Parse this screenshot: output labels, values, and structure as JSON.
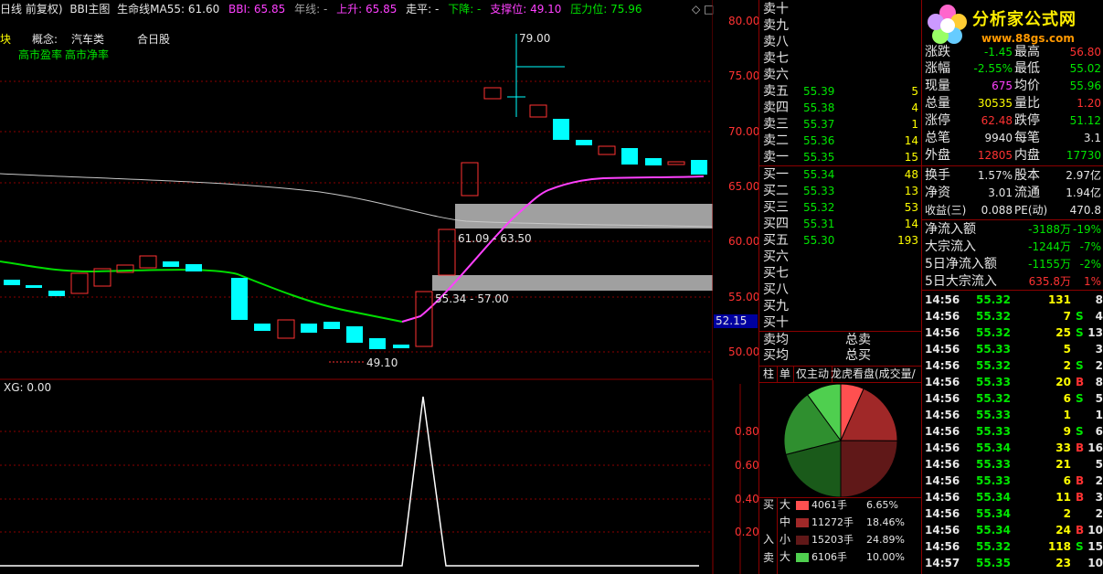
{
  "header": {
    "period": "日线 前复权)",
    "main_indicator": "BBI主图",
    "ma55": "生命线MA55: 61.60",
    "bbi": "BBI: 65.85",
    "nian": "年线: -",
    "up": "上升: 65.85",
    "flat": "走平: -",
    "down": "下降: -",
    "support": "支撑位: 49.10",
    "resistance": "压力位: 75.96"
  },
  "tags": {
    "sector": "块",
    "concept_label": "概念:",
    "concept_value": "汽车类",
    "concept_extra": "合日股",
    "tag1": "高市盈率",
    "tag2": "高市净率"
  },
  "annotations": {
    "high_label": "79.00",
    "low_label": "49.10",
    "zone_upper": "61.09 - 63.50",
    "zone_lower": "55.34 - 57.00",
    "current_price_tag": "52.15"
  },
  "y_axis_main": [
    "80.00",
    "75.00",
    "70.00",
    "65.00",
    "60.00",
    "55.00",
    "50.00"
  ],
  "sub_chart": {
    "title": "XG: 0.00",
    "y_axis": [
      "0.80",
      "0.60",
      "0.40",
      "0.20"
    ]
  },
  "order_book": {
    "sell": [
      {
        "label": "卖十",
        "price": "",
        "vol": ""
      },
      {
        "label": "卖九",
        "price": "",
        "vol": ""
      },
      {
        "label": "卖八",
        "price": "",
        "vol": ""
      },
      {
        "label": "卖七",
        "price": "",
        "vol": ""
      },
      {
        "label": "卖六",
        "price": "",
        "vol": ""
      },
      {
        "label": "卖五",
        "price": "55.39",
        "vol": "5"
      },
      {
        "label": "卖四",
        "price": "55.38",
        "vol": "4"
      },
      {
        "label": "卖三",
        "price": "55.37",
        "vol": "1"
      },
      {
        "label": "卖二",
        "price": "55.36",
        "vol": "14"
      },
      {
        "label": "卖一",
        "price": "55.35",
        "vol": "15"
      }
    ],
    "buy": [
      {
        "label": "买一",
        "price": "55.34",
        "vol": "48"
      },
      {
        "label": "买二",
        "price": "55.33",
        "vol": "13"
      },
      {
        "label": "买三",
        "price": "55.32",
        "vol": "53"
      },
      {
        "label": "买四",
        "price": "55.31",
        "vol": "14"
      },
      {
        "label": "买五",
        "price": "55.30",
        "vol": "193"
      },
      {
        "label": "买六",
        "price": "",
        "vol": ""
      },
      {
        "label": "买七",
        "price": "",
        "vol": ""
      },
      {
        "label": "买八",
        "price": "",
        "vol": ""
      },
      {
        "label": "买九",
        "price": "",
        "vol": ""
      },
      {
        "label": "买十",
        "price": "",
        "vol": ""
      }
    ],
    "avg": {
      "sell_avg": "卖均",
      "buy_avg": "买均",
      "total_sell": "总卖",
      "total_buy": "总买"
    }
  },
  "tabs": [
    "柱",
    "单",
    "仅主动",
    "龙虎看盘(成交量/形"
  ],
  "pie": {
    "slices": [
      {
        "name": "大买",
        "pct": 6.65,
        "color": "#ff5050"
      },
      {
        "name": "中买",
        "pct": 18.46,
        "color": "#a02828"
      },
      {
        "name": "小买",
        "pct": 24.89,
        "color": "#601818"
      },
      {
        "name": "小卖",
        "pct": 21.0,
        "color": "#1a5a1a"
      },
      {
        "name": "中卖",
        "pct": 19.0,
        "color": "#2f8f2f"
      },
      {
        "name": "大卖",
        "pct": 10.0,
        "color": "#4fcf4f"
      }
    ]
  },
  "flow_legend": {
    "buy_label": "买",
    "in_label": "入",
    "sell_label": "卖",
    "rows": [
      {
        "size": "大",
        "amount": "4061手",
        "pct": "6.65%",
        "color": "#ff5050"
      },
      {
        "size": "中",
        "amount": "11272手",
        "pct": "18.46%",
        "color": "#a02828"
      },
      {
        "size": "小",
        "amount": "15203手",
        "pct": "24.89%",
        "color": "#601818"
      },
      {
        "size": "大",
        "amount": "6106手",
        "pct": "10.00%",
        "color": "#4fcf4f"
      }
    ]
  },
  "logo": {
    "title": "分析家公式网",
    "url": "www.88gs.com"
  },
  "quote": {
    "top_partial": {
      "l": "涨跌",
      "v": "-1.45",
      "l2": "最高",
      "v2": "56.80"
    },
    "rows": [
      {
        "l": "涨幅",
        "v": "-2.55%",
        "vc": "green",
        "l2": "最低",
        "v2": "55.02",
        "v2c": "green"
      },
      {
        "l": "现量",
        "v": "675",
        "vc": "mag",
        "l2": "均价",
        "v2": "55.96",
        "v2c": "green"
      },
      {
        "l": "总量",
        "v": "30535",
        "vc": "yellow",
        "l2": "量比",
        "v2": "1.20",
        "v2c": "red"
      },
      {
        "l": "涨停",
        "v": "62.48",
        "vc": "red",
        "l2": "跌停",
        "v2": "51.12",
        "v2c": "green"
      },
      {
        "l": "总笔",
        "v": "9940",
        "vc": "white",
        "l2": "每笔",
        "v2": "3.1",
        "v2c": "white"
      },
      {
        "l": "外盘",
        "v": "12805",
        "vc": "red",
        "l2": "内盘",
        "v2": "17730",
        "v2c": "green"
      }
    ],
    "rows2": [
      {
        "l": "换手",
        "v": "1.57%",
        "l2": "股本",
        "v2": "2.97亿"
      },
      {
        "l": "净资",
        "v": "3.01",
        "l2": "流通",
        "v2": "1.94亿"
      },
      {
        "l": "收益(三)",
        "v": "0.088",
        "l2": "PE(动)",
        "v2": "470.8"
      }
    ],
    "flows": [
      {
        "l": "净流入额",
        "v": "-3188万",
        "p": "-19%"
      },
      {
        "l": "大宗流入",
        "v": "-1244万",
        "p": "-7%"
      },
      {
        "l": "5日净流入额",
        "v": "-1155万",
        "p": "-2%"
      },
      {
        "l": "5日大宗流入",
        "v": "635.8万",
        "p": "1%"
      }
    ]
  },
  "ticks": [
    {
      "time": "14:56",
      "price": "55.32",
      "vol": "131",
      "side": "",
      "n": "8"
    },
    {
      "time": "14:56",
      "price": "55.32",
      "vol": "7",
      "side": "S",
      "n": "4"
    },
    {
      "time": "14:56",
      "price": "55.32",
      "vol": "25",
      "side": "S",
      "n": "13"
    },
    {
      "time": "14:56",
      "price": "55.33",
      "vol": "5",
      "side": "",
      "n": "3"
    },
    {
      "time": "14:56",
      "price": "55.32",
      "vol": "2",
      "side": "S",
      "n": "2"
    },
    {
      "time": "14:56",
      "price": "55.33",
      "vol": "20",
      "side": "B",
      "n": "8"
    },
    {
      "time": "14:56",
      "price": "55.32",
      "vol": "6",
      "side": "S",
      "n": "5"
    },
    {
      "time": "14:56",
      "price": "55.33",
      "vol": "1",
      "side": "",
      "n": "1"
    },
    {
      "time": "14:56",
      "price": "55.33",
      "vol": "9",
      "side": "S",
      "n": "6"
    },
    {
      "time": "14:56",
      "price": "55.34",
      "vol": "33",
      "side": "B",
      "n": "16"
    },
    {
      "time": "14:56",
      "price": "55.33",
      "vol": "21",
      "side": "",
      "n": "5"
    },
    {
      "time": "14:56",
      "price": "55.33",
      "vol": "6",
      "side": "B",
      "n": "2"
    },
    {
      "time": "14:56",
      "price": "55.34",
      "vol": "11",
      "side": "B",
      "n": "3"
    },
    {
      "time": "14:56",
      "price": "55.34",
      "vol": "2",
      "side": "",
      "n": "2"
    },
    {
      "time": "14:56",
      "price": "55.34",
      "vol": "24",
      "side": "B",
      "n": "10"
    },
    {
      "time": "14:56",
      "price": "55.32",
      "vol": "118",
      "side": "S",
      "n": "15"
    },
    {
      "time": "14:57",
      "price": "55.35",
      "vol": "23",
      "side": "",
      "n": "10"
    }
  ],
  "colors": {
    "up": "#ff3232",
    "down": "#00ffff",
    "grid": "#8b0000",
    "ma55": "#00dd00",
    "bbi": "#ff40ff",
    "nian": "#c8c8c8"
  }
}
